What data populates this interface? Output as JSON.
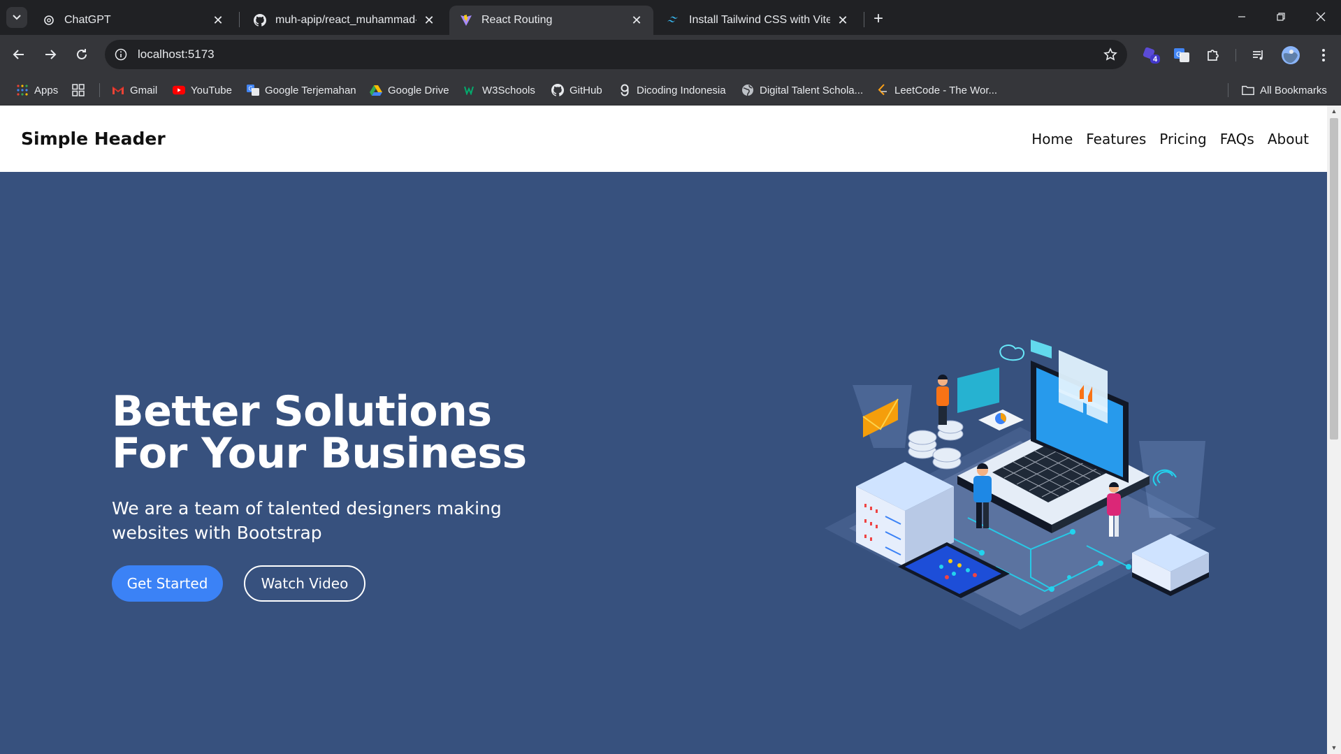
{
  "tabs": [
    {
      "title": "ChatGPT",
      "icon": "chatgpt-icon"
    },
    {
      "title": "muh-apip/react_muhammad-h",
      "icon": "github-icon"
    },
    {
      "title": "React Routing",
      "icon": "vite-icon",
      "active": true
    },
    {
      "title": "Install Tailwind CSS with Vite - T",
      "icon": "tailwind-icon"
    }
  ],
  "address": {
    "url": "localhost:5173"
  },
  "extensions": {
    "badge_count": "4"
  },
  "bookmarks": {
    "apps": "Apps",
    "items": [
      "Gmail",
      "YouTube",
      "Google Terjemahan",
      "Google Drive",
      "W3Schools",
      "GitHub",
      "Dicoding Indonesia",
      "Digital Talent Schola...",
      "LeetCode - The Wor..."
    ],
    "all": "All Bookmarks"
  },
  "site": {
    "logo": "Simple Header",
    "nav": [
      "Home",
      "Features",
      "Pricing",
      "FAQs",
      "About"
    ]
  },
  "hero": {
    "title": "Better Solutions For Your Business",
    "subtitle": "We are a team of talented designers making websites with Bootstrap",
    "primary_button": "Get Started",
    "secondary_button": "Watch Video"
  },
  "colors": {
    "hero_bg": "#37517e",
    "primary_btn": "#3b82f6",
    "chrome_dark": "#202124",
    "chrome_mid": "#35363a"
  }
}
